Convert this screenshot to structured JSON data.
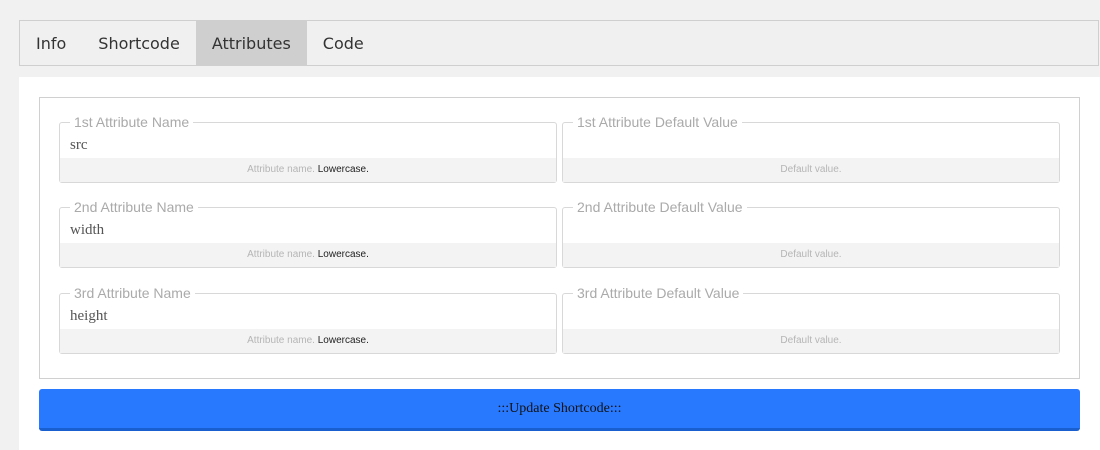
{
  "tabs": [
    {
      "label": "Info",
      "active": false
    },
    {
      "label": "Shortcode",
      "active": false
    },
    {
      "label": "Attributes",
      "active": true
    },
    {
      "label": "Code",
      "active": false
    }
  ],
  "fields": [
    {
      "name_legend": "1st Attribute Name",
      "name_value": "src",
      "name_help": "Attribute name.",
      "name_help_emphasis": "Lowercase.",
      "default_legend": "1st Attribute Default Value",
      "default_value": "",
      "default_help": "Default value."
    },
    {
      "name_legend": "2nd Attribute Name",
      "name_value": "width",
      "name_help": "Attribute name.",
      "name_help_emphasis": "Lowercase.",
      "default_legend": "2nd Attribute Default Value",
      "default_value": "",
      "default_help": "Default value."
    },
    {
      "name_legend": "3rd Attribute Name",
      "name_value": "height",
      "name_help": "Attribute name.",
      "name_help_emphasis": "Lowercase.",
      "default_legend": "3rd Attribute Default Value",
      "default_value": "",
      "default_help": "Default value."
    }
  ],
  "update_button": ":::Update Shortcode:::",
  "colors": {
    "button": "#2979ff",
    "active_tab": "#cfcfcf"
  }
}
